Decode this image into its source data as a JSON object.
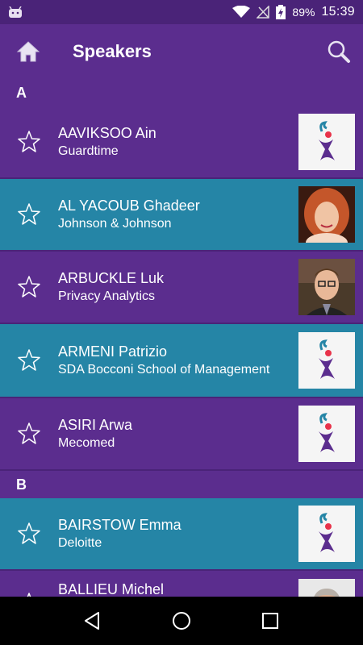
{
  "status_bar": {
    "battery_percent": "89%",
    "time": "15:39"
  },
  "app_bar": {
    "title": "Speakers"
  },
  "sections": [
    {
      "letter": "A",
      "speakers": [
        {
          "name": "AAVIKSOO Ain",
          "company": "Guardtime",
          "row_color": "purple",
          "photo": "logo"
        },
        {
          "name": "AL YACOUB Ghadeer",
          "company": "Johnson & Johnson",
          "row_color": "teal",
          "photo": "portrait-woman"
        },
        {
          "name": "ARBUCKLE Luk",
          "company": "Privacy Analytics",
          "row_color": "purple",
          "photo": "portrait-man"
        },
        {
          "name": "ARMENI Patrizio",
          "company": "SDA Bocconi School of Management",
          "row_color": "teal",
          "photo": "logo"
        },
        {
          "name": "ASIRI Arwa",
          "company": "Mecomed",
          "row_color": "purple",
          "photo": "logo"
        }
      ]
    },
    {
      "letter": "B",
      "speakers": [
        {
          "name": "BAIRSTOW Emma",
          "company": "Deloitte",
          "row_color": "teal",
          "photo": "logo"
        },
        {
          "name": "BALLIEU Michel",
          "company": "",
          "row_color": "purple",
          "photo": "portrait-older-man"
        }
      ]
    }
  ],
  "colors": {
    "primary_purple": "#5b2d8e",
    "teal": "#2585a6",
    "status_bar": "#4a2378"
  },
  "icons": {
    "home": "home-icon",
    "search": "search-icon",
    "favorite": "star-outline-icon",
    "nav_back": "back-triangle-icon",
    "nav_home": "home-circle-icon",
    "nav_recents": "recents-square-icon"
  }
}
